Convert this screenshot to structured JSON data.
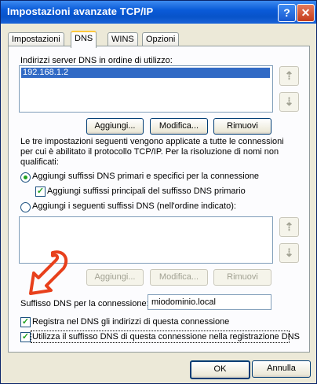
{
  "window": {
    "title": "Impostazioni avanzate TCP/IP",
    "help_glyph": "?",
    "close_glyph": "✕"
  },
  "tabs": [
    {
      "label": "Impostazioni IP"
    },
    {
      "label": "DNS"
    },
    {
      "label": "WINS"
    },
    {
      "label": "Opzioni"
    }
  ],
  "dns_servers": {
    "label": "Indirizzi server DNS in ordine di utilizzo:",
    "items": [
      "192.168.1.2"
    ],
    "up_glyph": "⇡",
    "down_glyph": "⇣"
  },
  "server_buttons": {
    "add": "Aggiungi...",
    "edit": "Modifica...",
    "remove": "Rimuovi"
  },
  "description": "Le tre impostazioni seguenti vengono applicate a tutte le connessioni per cui è abilitato il protocollo TCP/IP. Per la risoluzione di nomi non qualificati:",
  "options": {
    "radio_primary": "Aggiungi suffissi DNS primari e specifici per la connessione",
    "check_parent": "Aggiungi suffissi principali del suffisso DNS primario",
    "radio_custom": "Aggiungi i seguenti suffissi DNS (nell'ordine indicato):"
  },
  "suffix_buttons": {
    "add": "Aggiungi...",
    "edit": "Modifica...",
    "remove": "Rimuovi"
  },
  "suffix_field": {
    "label": "Suffisso DNS per la connessione:",
    "value": "miodominio.local"
  },
  "checks": {
    "register": "Registra nel DNS gli indirizzi di questa connessione",
    "use_suffix": "Utilizza il suffisso DNS di questa connessione nella registrazione DNS"
  },
  "footer": {
    "ok": "OK",
    "cancel": "Annulla"
  },
  "colors": {
    "title_bar": "#0a5bd9",
    "selection": "#316ac5",
    "annotation_arrow": "#e8401c"
  }
}
